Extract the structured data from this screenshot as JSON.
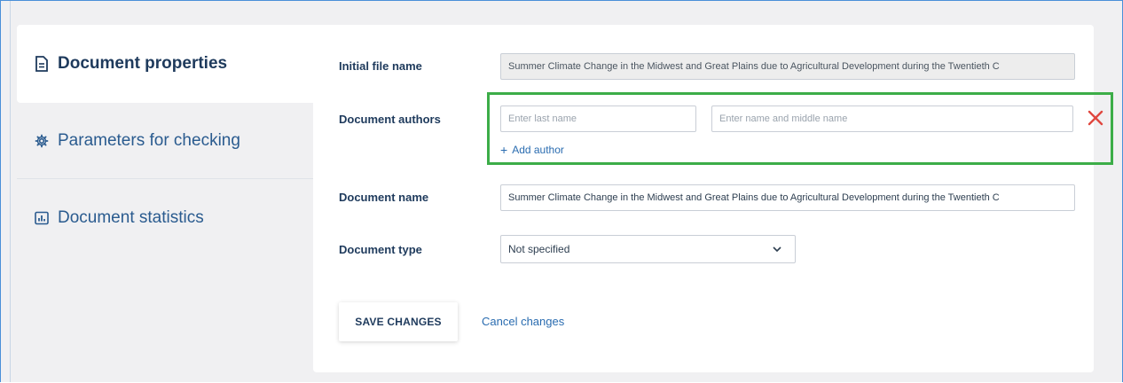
{
  "sidebar": {
    "items": [
      {
        "label": "Document properties",
        "icon": "document-icon",
        "active": true
      },
      {
        "label": "Parameters for checking",
        "icon": "gear-icon",
        "active": false
      },
      {
        "label": "Document statistics",
        "icon": "chart-icon",
        "active": false
      }
    ]
  },
  "form": {
    "initial_file_name": {
      "label": "Initial file name",
      "value": "Summer Climate Change in the Midwest and Great Plains due to Agricultural Development during the Twentieth C"
    },
    "authors": {
      "label": "Document authors",
      "last_name_placeholder": "Enter last name",
      "first_name_placeholder": "Enter name and middle name",
      "add_author": "Add author"
    },
    "document_name": {
      "label": "Document name",
      "value": "Summer Climate Change in the Midwest and Great Plains due to Agricultural Development during the Twentieth C"
    },
    "document_type": {
      "label": "Document type",
      "selected": "Not specified"
    }
  },
  "actions": {
    "save": "SAVE CHANGES",
    "cancel": "Cancel changes"
  },
  "colors": {
    "highlight_box": "#3cad48",
    "remove_icon": "#e0473f",
    "link": "#2a6cb0"
  }
}
